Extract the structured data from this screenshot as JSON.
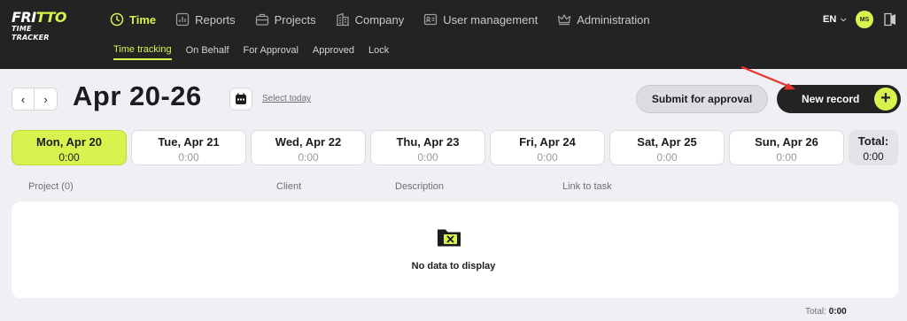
{
  "app": {
    "logo_line1": "FRITTO",
    "logo_line2": "TIME TRACKER"
  },
  "nav": [
    {
      "label": "Time",
      "icon": "clock-icon",
      "active": true
    },
    {
      "label": "Reports",
      "icon": "chart-icon"
    },
    {
      "label": "Projects",
      "icon": "briefcase-icon"
    },
    {
      "label": "Company",
      "icon": "building-icon"
    },
    {
      "label": "User management",
      "icon": "id-card-icon"
    },
    {
      "label": "Administration",
      "icon": "crown-icon"
    }
  ],
  "subnav": [
    "Time tracking",
    "On Behalf",
    "For Approval",
    "Approved",
    "Lock"
  ],
  "lang": "EN",
  "avatar": "MS",
  "header": {
    "prev": "‹",
    "next": "›",
    "week_title": "Apr 20-26",
    "select_today": "Select today",
    "submit_label": "Submit for approval",
    "new_record_label": "New record",
    "plus": "+"
  },
  "days": [
    {
      "name": "Mon, Apr 20",
      "value": "0:00"
    },
    {
      "name": "Tue, Apr 21",
      "value": "0:00"
    },
    {
      "name": "Wed, Apr 22",
      "value": "0:00"
    },
    {
      "name": "Thu, Apr 23",
      "value": "0:00"
    },
    {
      "name": "Fri, Apr 24",
      "value": "0:00"
    },
    {
      "name": "Sat, Apr 25",
      "value": "0:00"
    },
    {
      "name": "Sun, Apr 26",
      "value": "0:00"
    }
  ],
  "week_total": {
    "label": "Total:",
    "value": "0:00"
  },
  "table": {
    "columns": [
      "Project (0)",
      "Client",
      "Description",
      "Link to task"
    ],
    "empty_text": "No data to display"
  },
  "footer": {
    "total_label": "Total:",
    "total_value": "0:00"
  },
  "colors": {
    "accent": "#d8f24e",
    "topbar": "#232323",
    "background": "#efeff4",
    "annotation_arrow": "#e8352b"
  }
}
